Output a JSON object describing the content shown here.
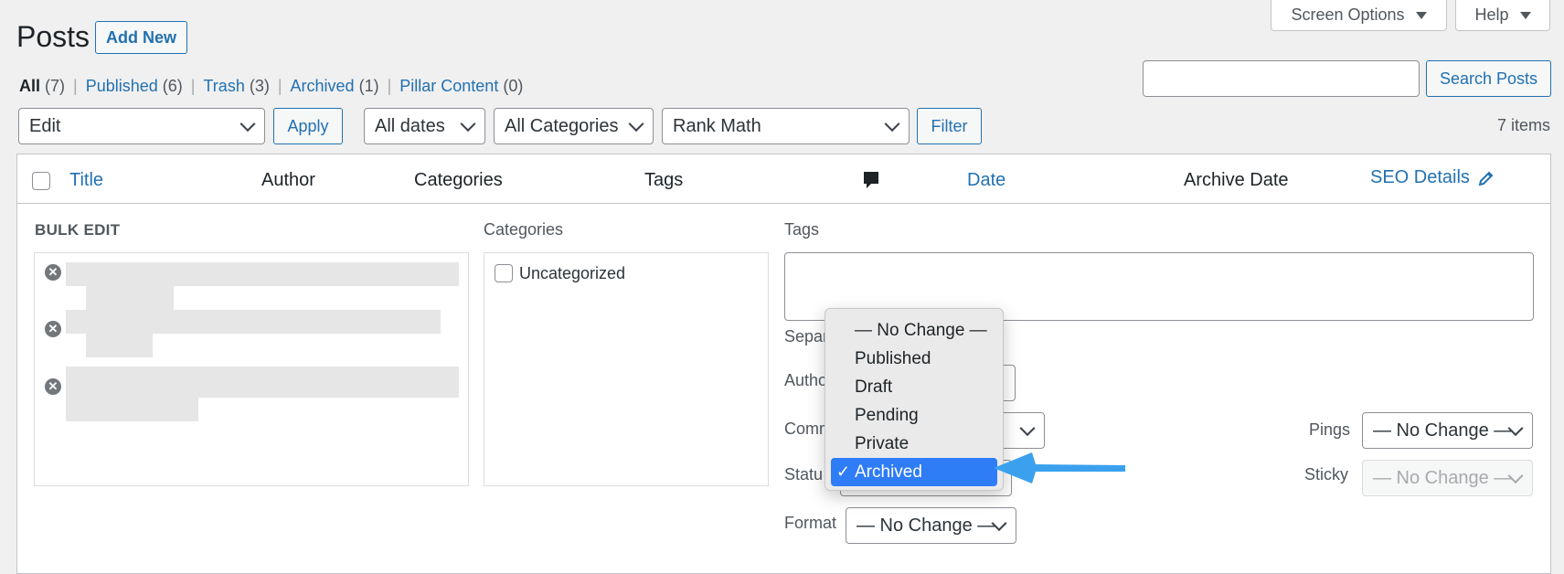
{
  "header": {
    "title": "Posts",
    "add_new": "Add New",
    "screen_options": "Screen Options",
    "help": "Help"
  },
  "subsubsub": [
    {
      "label": "All",
      "count": "(7)"
    },
    {
      "label": "Published",
      "count": "(6)"
    },
    {
      "label": "Trash",
      "count": "(3)"
    },
    {
      "label": "Archived",
      "count": "(1)"
    },
    {
      "label": "Pillar Content",
      "count": "(0)"
    }
  ],
  "search": {
    "value": "",
    "button": "Search Posts"
  },
  "tablenav": {
    "bulk_action": "Edit",
    "apply": "Apply",
    "dates": "All dates",
    "categories": "All Categories",
    "rank_math": "Rank Math",
    "filter": "Filter",
    "items_count": "7 items"
  },
  "table": {
    "columns": [
      "Title",
      "Author",
      "Categories",
      "Tags",
      "Date",
      "Archive Date",
      "SEO Details"
    ]
  },
  "bulk_edit": {
    "title": "BULK EDIT",
    "categories_label": "Categories",
    "category_item": "Uncategorized",
    "tags_label": "Tags",
    "separate_label": "Separ",
    "author_label": "Autho",
    "comments_label": "Comm",
    "status_label": "Statu",
    "format_label": "Format",
    "format_value": "— No Change —",
    "pings_label": "Pings",
    "pings_value": "— No Change —",
    "sticky_label": "Sticky",
    "sticky_value": "— No Change —"
  },
  "status_dropdown": {
    "options": [
      "— No Change —",
      "Published",
      "Draft",
      "Pending",
      "Private",
      "Archived"
    ],
    "selected": "Archived",
    "check_glyph": "✓"
  },
  "colors": {
    "link": "#2271b1",
    "selection": "#2e7cf6",
    "arrow": "#3ba1ee",
    "background": "#f0f0f1"
  }
}
